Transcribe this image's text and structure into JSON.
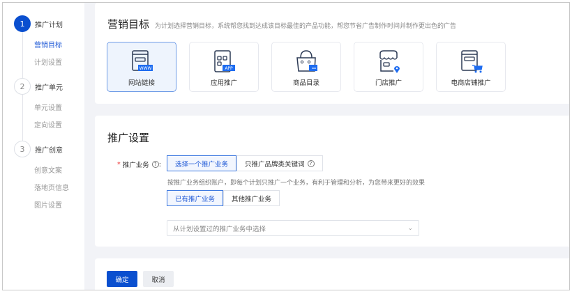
{
  "sidebar": {
    "steps": [
      {
        "num": "1",
        "label": "推广计划",
        "subs": [
          "营销目标",
          "计划设置"
        ]
      },
      {
        "num": "2",
        "label": "推广单元",
        "subs": [
          "单元设置",
          "定向设置"
        ]
      },
      {
        "num": "3",
        "label": "推广创意",
        "subs": [
          "创意文案",
          "落地页信息",
          "图片设置"
        ]
      }
    ]
  },
  "goal": {
    "title": "营销目标",
    "desc": "为计划选择营销目标，系统帮您找到达成该目标最佳的产品功能，帮您节省广告制作时间并制作更出色的广告",
    "cards": [
      {
        "label": "网站链接",
        "icon": "website-icon",
        "badge": "WWW"
      },
      {
        "label": "应用推广",
        "icon": "app-icon",
        "badge": "APP"
      },
      {
        "label": "商品目录",
        "icon": "shopping-bag-icon"
      },
      {
        "label": "门店推广",
        "icon": "store-icon"
      },
      {
        "label": "电商店铺推广",
        "icon": "ecommerce-cart-icon"
      }
    ]
  },
  "settings": {
    "title": "推广设置",
    "field_label": "推广业务",
    "required": "*",
    "colon": ":",
    "mode_options": [
      "选择一个推广业务",
      "只推广品牌类关键词"
    ],
    "hint": "按推广业务组织账户，即每个计划只推广一个业务，有利于管理和分析，为您带来更好的效果",
    "source_options": [
      "已有推广业务",
      "其他推广业务"
    ],
    "select_placeholder": "从计划设置过的推广业务中选择"
  },
  "footer": {
    "confirm": "确定",
    "cancel": "取消"
  },
  "colors": {
    "accent": "#0a4fcf",
    "link": "#1e58d6"
  }
}
